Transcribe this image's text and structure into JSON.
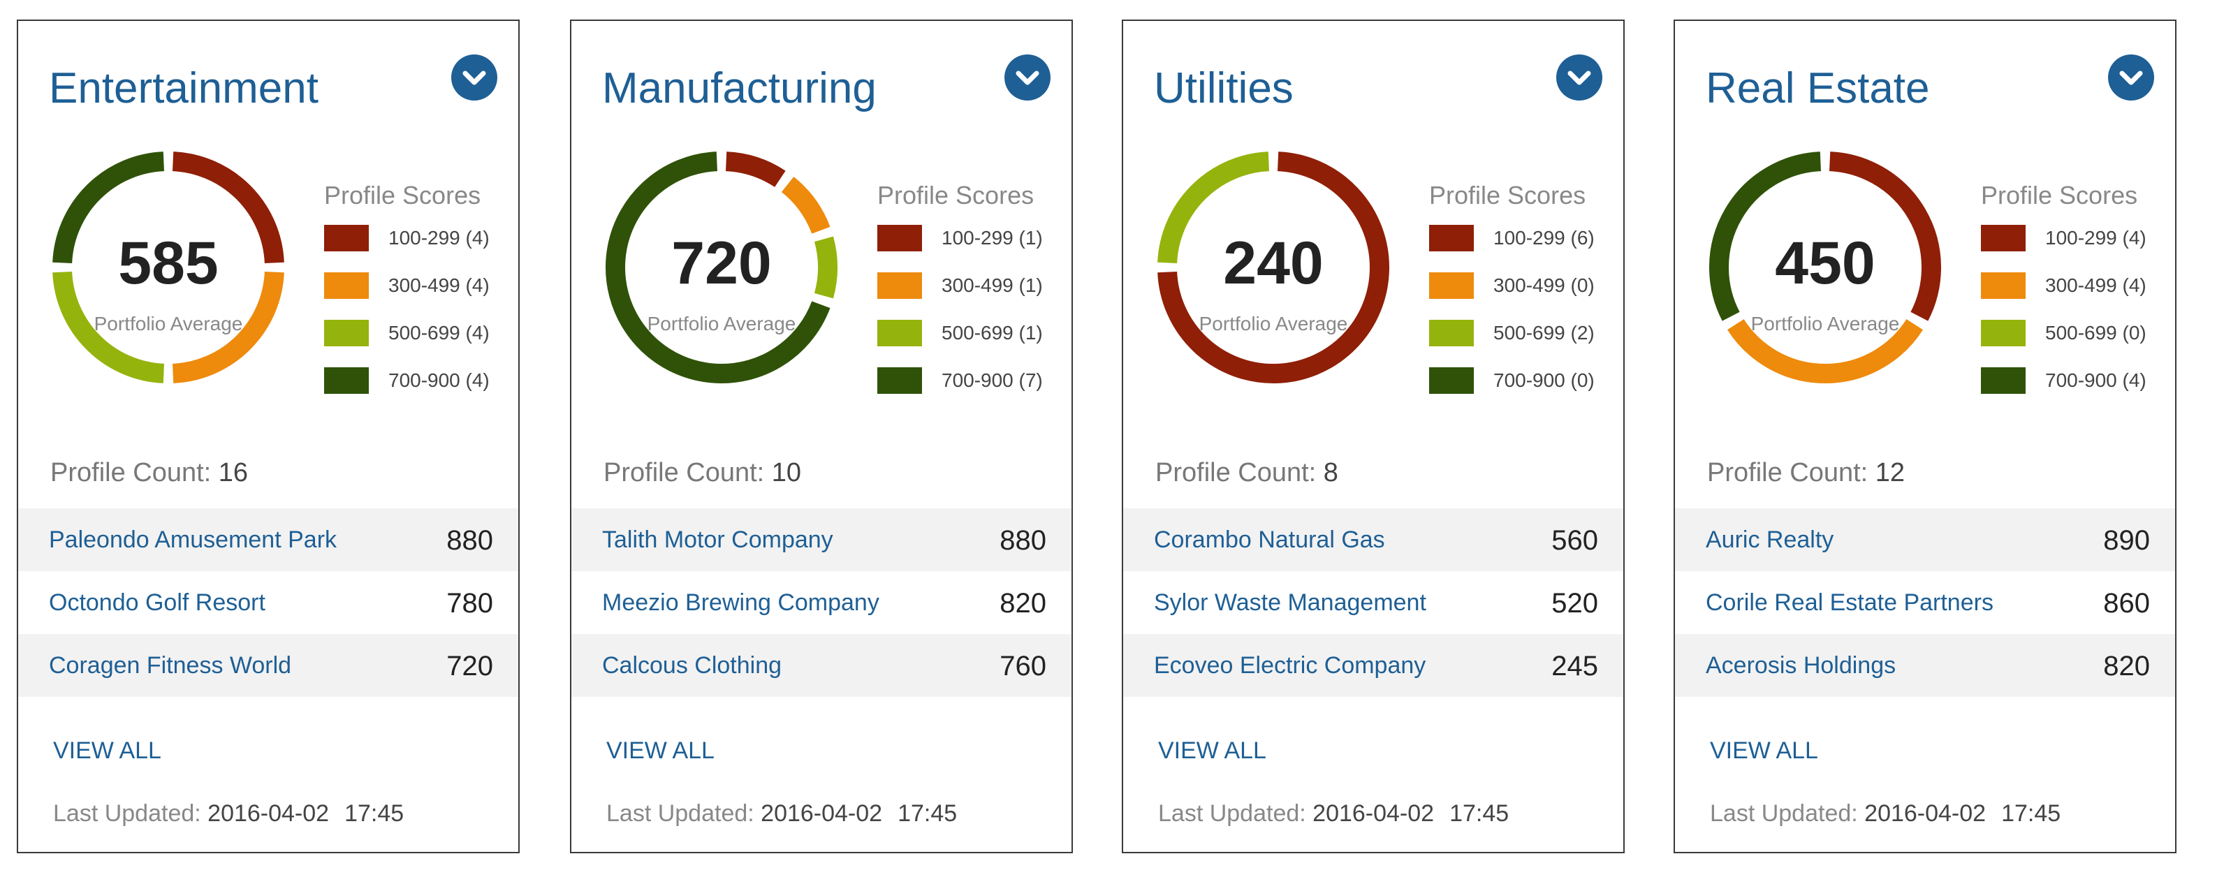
{
  "colors": {
    "accent": "#1e5f95",
    "band_100_299": "#8f1f07",
    "band_300_499": "#ee8a0c",
    "band_500_699": "#95b30d",
    "band_700_900": "#2f5208"
  },
  "common": {
    "donut_caption": "Portfolio Average",
    "legend_title": "Profile Scores",
    "count_label": "Profile Count:",
    "view_all": "VIEW ALL",
    "updated_label": "Last Updated:",
    "updated_date": "2016-04-02",
    "updated_time": "17:45",
    "expand_icon": "chevron-down-icon"
  },
  "cards": [
    {
      "title": "Entertainment",
      "average": "585",
      "legend": [
        {
          "label": "100-299 (4)",
          "count": 4
        },
        {
          "label": "300-499 (4)",
          "count": 4
        },
        {
          "label": "500-699 (4)",
          "count": 4
        },
        {
          "label": "700-900 (4)",
          "count": 4
        }
      ],
      "profile_count": "16",
      "top": [
        {
          "name": "Paleondo Amusement Park",
          "score": "880"
        },
        {
          "name": "Octondo Golf Resort",
          "score": "780"
        },
        {
          "name": "Coragen Fitness World",
          "score": "720"
        }
      ]
    },
    {
      "title": "Manufacturing",
      "average": "720",
      "legend": [
        {
          "label": "100-299 (1)",
          "count": 1
        },
        {
          "label": "300-499 (1)",
          "count": 1
        },
        {
          "label": "500-699 (1)",
          "count": 1
        },
        {
          "label": "700-900 (7)",
          "count": 7
        }
      ],
      "profile_count": "10",
      "top": [
        {
          "name": "Talith Motor Company",
          "score": "880"
        },
        {
          "name": "Meezio Brewing Company",
          "score": "820"
        },
        {
          "name": "Calcous Clothing",
          "score": "760"
        }
      ]
    },
    {
      "title": "Utilities",
      "average": "240",
      "legend": [
        {
          "label": "100-299 (6)",
          "count": 6
        },
        {
          "label": "300-499 (0)",
          "count": 0
        },
        {
          "label": "500-699 (2)",
          "count": 2
        },
        {
          "label": "700-900 (0)",
          "count": 0
        }
      ],
      "profile_count": "8",
      "top": [
        {
          "name": "Corambo Natural Gas",
          "score": "560"
        },
        {
          "name": "Sylor Waste Management",
          "score": "520"
        },
        {
          "name": "Ecoveo Electric Company",
          "score": "245"
        }
      ]
    },
    {
      "title": "Real Estate",
      "average": "450",
      "legend": [
        {
          "label": "100-299 (4)",
          "count": 4
        },
        {
          "label": "300-499 (4)",
          "count": 4
        },
        {
          "label": "500-699 (0)",
          "count": 0
        },
        {
          "label": "700-900 (4)",
          "count": 4
        }
      ],
      "profile_count": "12",
      "top": [
        {
          "name": "Auric Realty",
          "score": "890"
        },
        {
          "name": "Corile Real Estate Partners",
          "score": "860"
        },
        {
          "name": "Acerosis Holdings",
          "score": "820"
        }
      ]
    }
  ]
}
